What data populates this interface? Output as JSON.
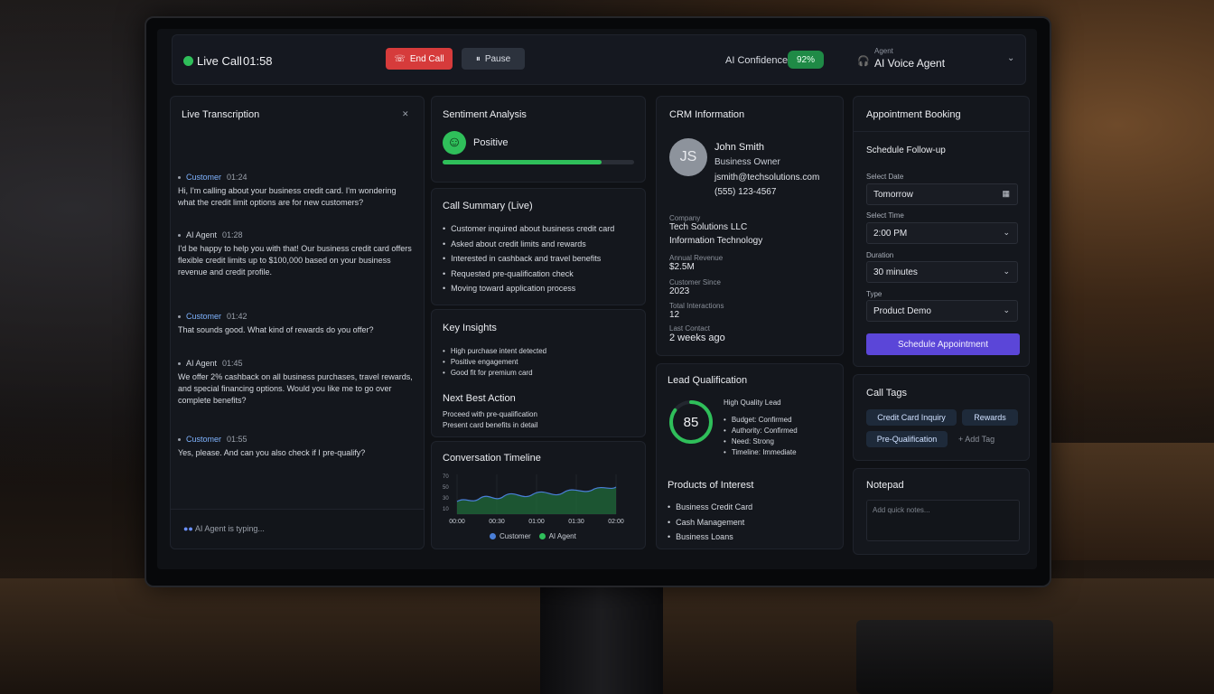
{
  "topbar": {
    "live_label": "Live Call",
    "live_time": "01:58",
    "end_call_label": "End Call",
    "pause_label": "Pause",
    "confidence_label": "AI Confidence",
    "confidence_value": "92%",
    "agent_small_label": "Agent",
    "agent_name": "AI Voice Agent"
  },
  "transcription": {
    "title": "Live Transcription",
    "messages": [
      {
        "who": "Customer",
        "time": "01:24",
        "text": "Hi, I'm calling about your business credit card. I'm wondering what the credit limit options are for new customers?"
      },
      {
        "who": "AI Agent",
        "time": "01:28",
        "text": "I'd be happy to help you with that! Our business credit card offers flexible credit limits up to $100,000 based on your business revenue and credit profile."
      },
      {
        "who": "Customer",
        "time": "01:42",
        "text": "That sounds good. What kind of rewards do you offer?"
      },
      {
        "who": "AI Agent",
        "time": "01:45",
        "text": "We offer 2% cashback on all business purchases, travel rewards, and special financing options. Would you like me to go over complete benefits?"
      },
      {
        "who": "Customer",
        "time": "01:55",
        "text": "Yes, please. And can you also check if I pre-qualify?"
      }
    ],
    "typing": "AI Agent is typing..."
  },
  "sentiment": {
    "title": "Sentiment Analysis",
    "label": "Positive",
    "level": 0.83
  },
  "summary": {
    "title": "Call Summary (Live)",
    "items": [
      "Customer inquired about business credit card",
      "Asked about credit limits and rewards",
      "Interested in cashback and travel benefits",
      "Requested pre-qualification check",
      "Moving toward application process"
    ]
  },
  "insights": {
    "title": "Key Insights",
    "items": [
      "High purchase intent detected",
      "Positive engagement",
      "Good fit for premium card"
    ],
    "next_title": "Next Best Action",
    "next_lines": [
      "Proceed with pre-qualification",
      "Present card benefits in detail"
    ]
  },
  "timeline": {
    "title": "Conversation Timeline",
    "x_ticks": [
      "00:00",
      "00:30",
      "01:00",
      "01:30",
      "02:00"
    ],
    "legend": [
      "Customer",
      "AI Agent"
    ]
  },
  "crm": {
    "title": "CRM Information",
    "initials": "JS",
    "name": "John Smith",
    "role": "Business Owner",
    "email": "jsmith@techsolutions.com",
    "phone": "(555) 123-4567",
    "company_label": "Company",
    "company_name": "Tech Solutions LLC",
    "industry": "Information Technology",
    "revenue_label": "Annual Revenue",
    "revenue": "$2.5M",
    "since_label": "Customer Since",
    "since": "2023",
    "interactions_label": "Total Interactions",
    "interactions": "12",
    "contact_label": "Last Contact",
    "contact": "2 weeks ago"
  },
  "lead": {
    "title": "Lead Qualification",
    "score": "85",
    "score_fraction": 0.85,
    "quality": "High Quality Lead",
    "items": [
      "Budget: Confirmed",
      "Authority: Confirmed",
      "Need: Strong",
      "Timeline: Immediate"
    ],
    "products_title": "Products of Interest",
    "products": [
      "Business Credit Card",
      "Cash Management",
      "Business Loans"
    ]
  },
  "appointment": {
    "title": "Appointment Booking",
    "subtitle": "Schedule Follow-up",
    "date_label": "Select Date",
    "date_value": "Tomorrow",
    "time_label": "Select Time",
    "time_value": "2:00 PM",
    "duration_label": "Duration",
    "duration_value": "30 minutes",
    "type_label": "Type",
    "type_value": "Product Demo",
    "button": "Schedule Appointment"
  },
  "tags": {
    "title": "Call Tags",
    "items": [
      "Credit Card Inquiry",
      "Rewards",
      "Pre-Qualification"
    ],
    "add": "+ Add Tag"
  },
  "notepad": {
    "title": "Notepad",
    "placeholder": "Add quick notes..."
  },
  "colors": {
    "accent": "#5b46d8",
    "positive": "#2fbf5a",
    "danger": "#d63b3b",
    "customer_series": "#4a7fd8",
    "agent_series": "#2fbf5a"
  }
}
